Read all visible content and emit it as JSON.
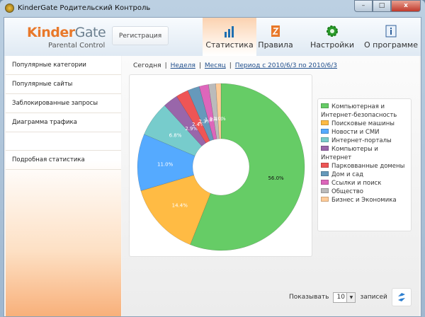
{
  "window": {
    "title": "KinderGate Родительский Контроль",
    "minimize": "–",
    "maximize": "□",
    "close": "x"
  },
  "header": {
    "logo_kinder": "Kinder",
    "logo_gate": "Gate",
    "logo_sub": "Parental Control",
    "register_label": "Регистрация",
    "tabs": [
      {
        "label": "Статистика",
        "icon": "bar-chart-icon",
        "active": true
      },
      {
        "label": "Правила",
        "icon": "rules-icon"
      },
      {
        "label": "Настройки",
        "icon": "gear-icon"
      },
      {
        "label": "О программе",
        "icon": "info-icon"
      }
    ]
  },
  "sidebar": {
    "items": [
      {
        "label": "Популярные категории"
      },
      {
        "label": "Популярные сайты"
      },
      {
        "label": "Заблокированные запросы"
      },
      {
        "label": "Диаграмма трафика"
      },
      {
        "label": ""
      },
      {
        "label": "Подробная статистика"
      }
    ]
  },
  "periods": {
    "today": "Сегодня",
    "week": "Неделя",
    "month": "Месяц",
    "range": "Период с 2010/6/3 по 2010/6/3",
    "separator": "|"
  },
  "chart_data": {
    "type": "pie",
    "donut": true,
    "categories": [
      "Компьютерная и Интернет-безопасность",
      "Поисковые машины",
      "Новости и СМИ",
      "Интернет-порталы",
      "Компьютеры и Интернет",
      "Парковванные домены",
      "Дом и сад",
      "Ссылки и поиск",
      "Общество",
      "Бизнес и Экономика"
    ],
    "values": [
      56.0,
      14.4,
      11.0,
      6.8,
      2.9,
      2.4,
      2.3,
      1.8,
      1.4,
      1.0
    ],
    "labels": [
      "56.0%",
      "14.4%",
      "11.0%",
      "6.8%",
      "2.9%",
      "2.4%",
      "2.3%",
      "1.8%",
      "1.4%",
      "1.0%"
    ],
    "colors": [
      "#66cc66",
      "#ffbb44",
      "#55aaff",
      "#77cccc",
      "#9966aa",
      "#ee5555",
      "#6699bb",
      "#dd66bb",
      "#bbbbbb",
      "#ffcc99"
    ],
    "legend_position": "right"
  },
  "footer": {
    "show_label": "Показывать",
    "count": "10",
    "records_label": "записей",
    "refresh_icon": "refresh-icon"
  }
}
